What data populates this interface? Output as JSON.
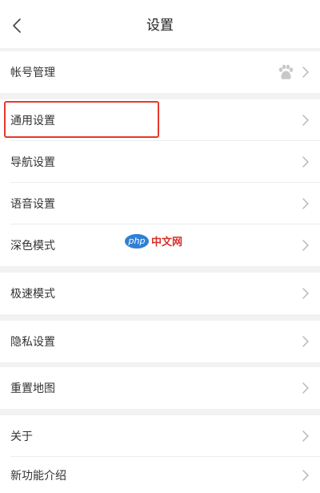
{
  "header": {
    "title": "设置",
    "back_icon": "chevron-left-icon"
  },
  "settings": [
    {
      "id": "account",
      "label": "帐号管理",
      "icon": "paw-icon"
    },
    {
      "id": "general",
      "label": "通用设置",
      "highlighted": true
    },
    {
      "id": "navigation",
      "label": "导航设置"
    },
    {
      "id": "voice",
      "label": "语音设置"
    },
    {
      "id": "dark-mode",
      "label": "深色模式"
    },
    {
      "id": "speed-mode",
      "label": "极速模式"
    },
    {
      "id": "privacy",
      "label": "隐私设置"
    },
    {
      "id": "reset-map",
      "label": "重置地图"
    },
    {
      "id": "about",
      "label": "关于"
    },
    {
      "id": "new-features",
      "label": "新功能介绍"
    }
  ],
  "watermark": {
    "badge": "php",
    "text": "中文网"
  },
  "colors": {
    "highlight": "#e5392c",
    "background": "#f2f2f2",
    "watermark_badge": "#2f7fd6",
    "watermark_text": "#d6312a"
  }
}
